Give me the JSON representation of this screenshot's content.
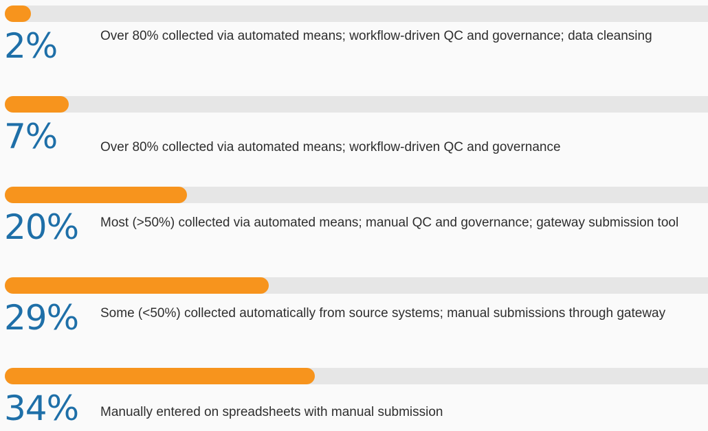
{
  "chart_data": {
    "type": "bar",
    "orientation": "horizontal",
    "xlim": [
      0,
      100
    ],
    "grid": false,
    "title": "",
    "xlabel": "",
    "ylabel": "",
    "colors": {
      "bar_fill": "#f7941d",
      "bar_track": "#e6e6e6",
      "percent_text": "#1e6fa8",
      "description_text": "#2e2e2e"
    },
    "items": [
      {
        "value": 2,
        "label": "2%",
        "description": "Over 80% collected via automated means;  workflow-driven QC and governance; data cleansing"
      },
      {
        "value": 7,
        "label": "7%",
        "description": "Over 80% collected via automated means; workflow-driven QC and governance"
      },
      {
        "value": 20,
        "label": "20%",
        "description": "Most (>50%) collected via automated means; manual QC and governance; gateway submission tool"
      },
      {
        "value": 29,
        "label": "29%",
        "description": "Some (<50%) collected automatically from source systems; manual submissions through gateway"
      },
      {
        "value": 34,
        "label": "34%",
        "description": "Manually entered on spreadsheets with manual submission"
      }
    ]
  }
}
